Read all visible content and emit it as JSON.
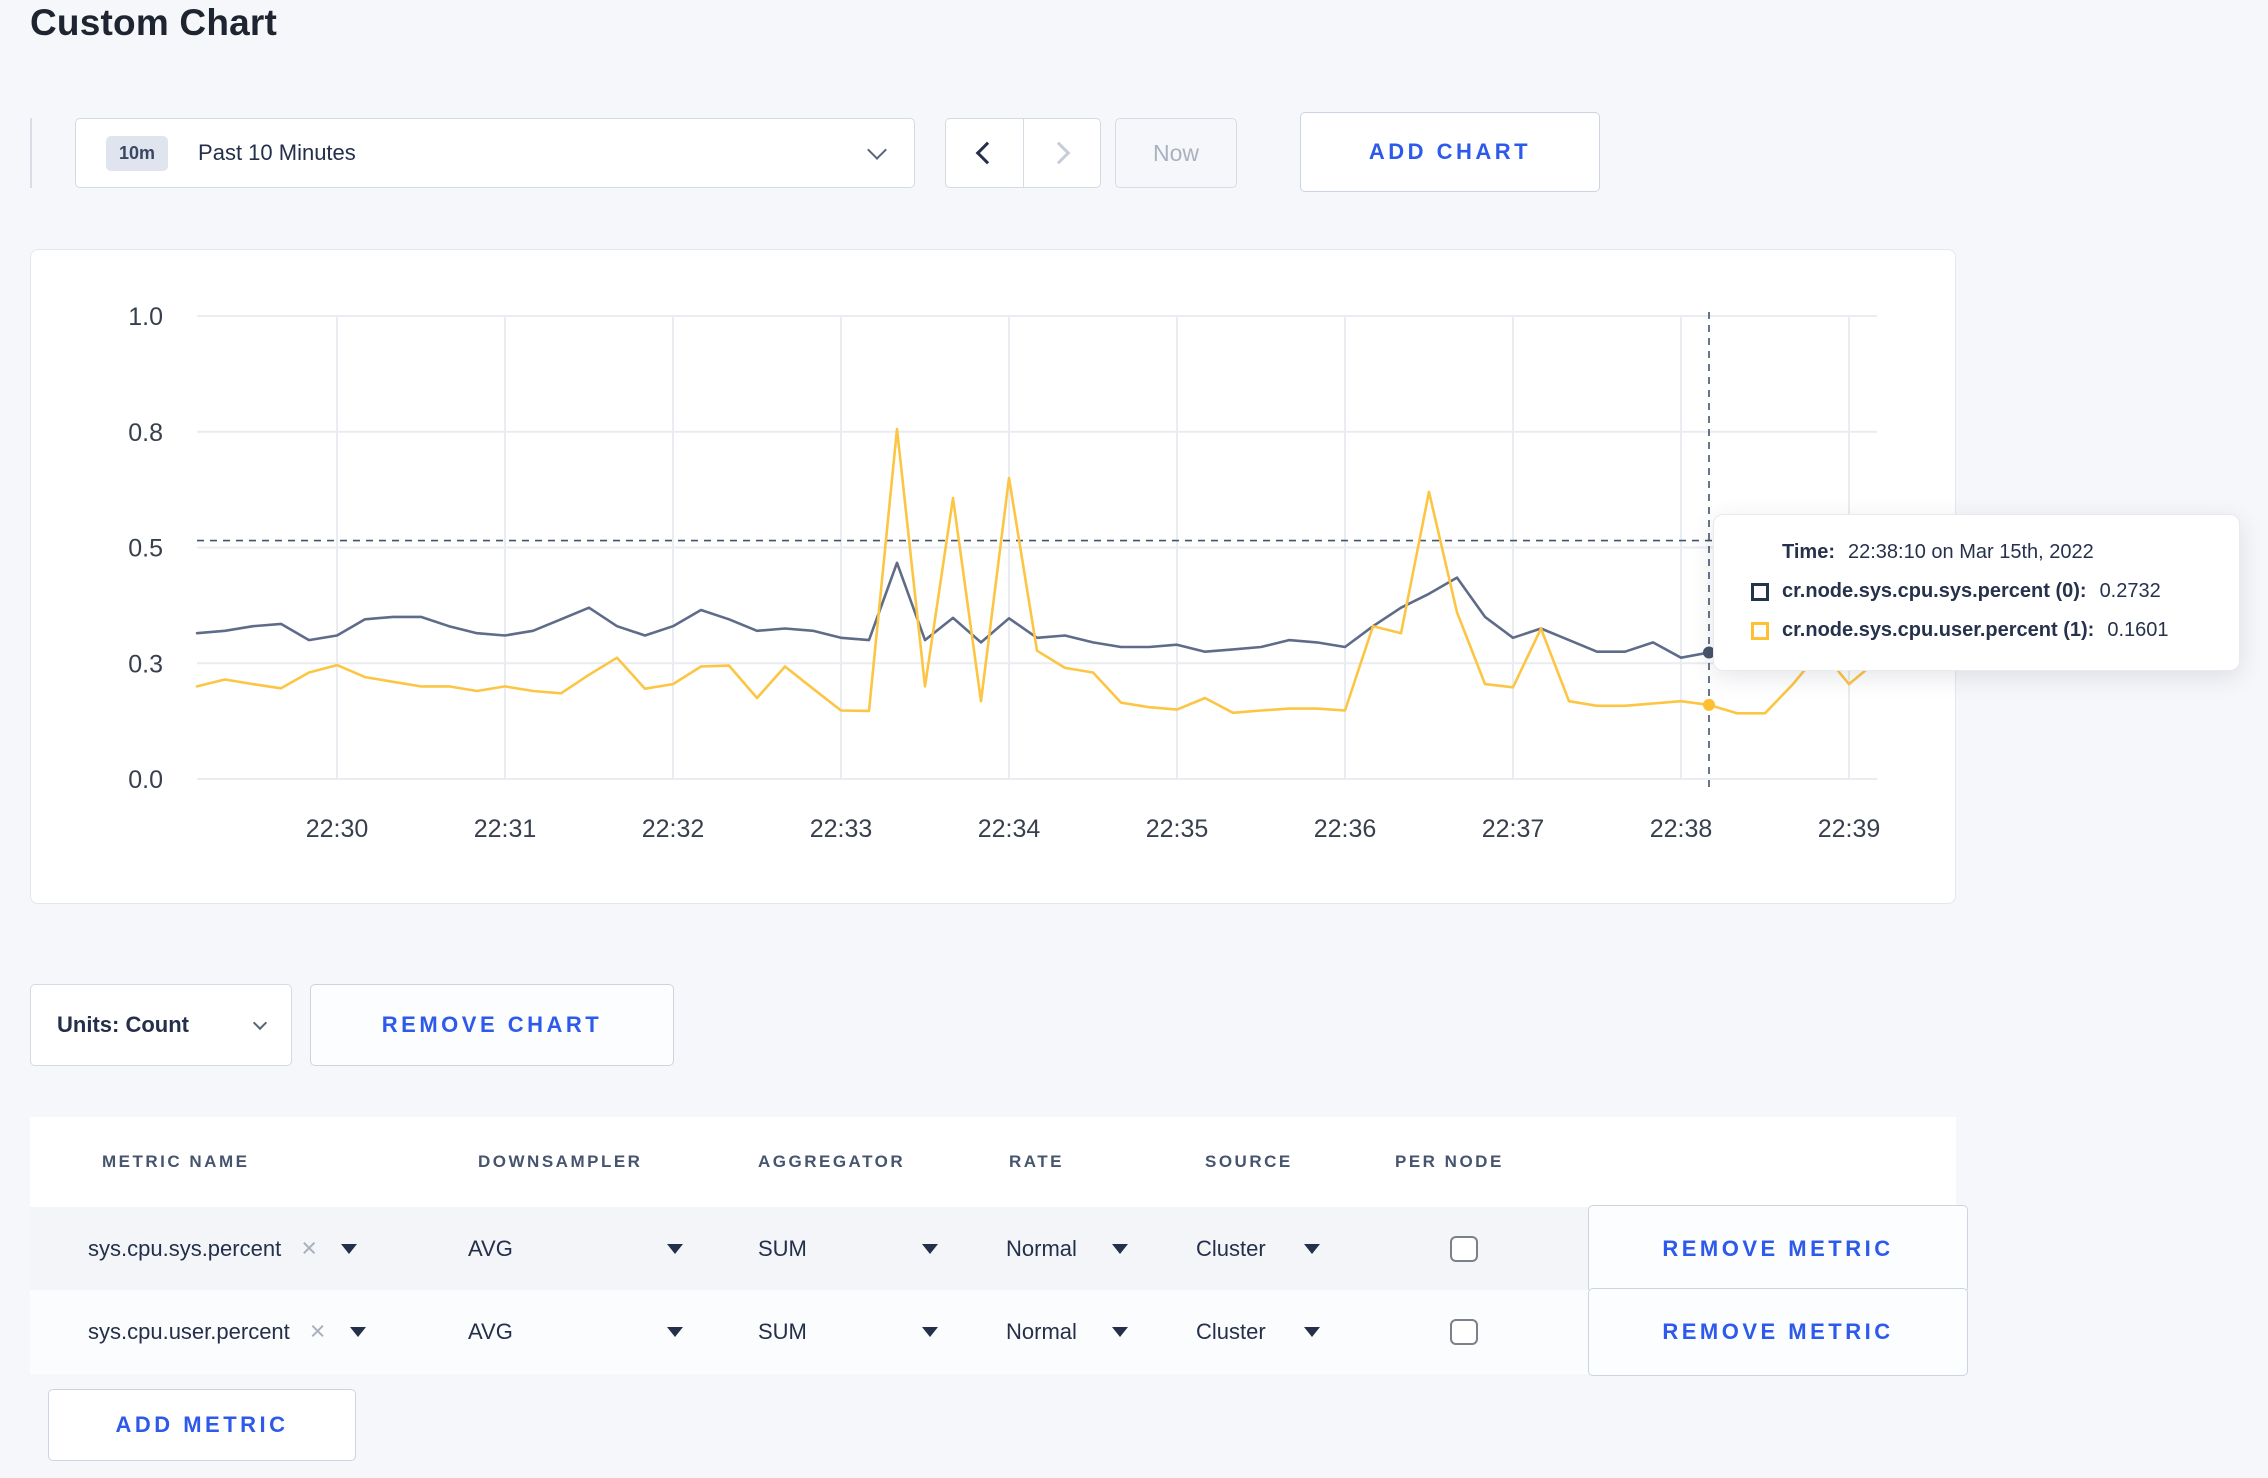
{
  "page": {
    "title": "Custom Chart",
    "background_color": "#f6f7fa",
    "accent_blue": "#2d5aeb"
  },
  "toolbar": {
    "time_badge": "10m",
    "time_label": "Past 10 Minutes",
    "now_label": "Now",
    "add_chart_label": "ADD CHART"
  },
  "chart_data": {
    "type": "line",
    "title": "",
    "xlabel": "",
    "ylabel": "",
    "ylim": [
      0,
      1
    ],
    "grid": true,
    "x_start_time": "22:29:10",
    "x_end_time": "22:39:10",
    "sample_interval_seconds": 10,
    "y_ticks": [
      {
        "v": 0,
        "label": "0.0"
      },
      {
        "v": 0.25,
        "label": "0.3"
      },
      {
        "v": 0.5,
        "label": "0.5"
      },
      {
        "v": 0.75,
        "label": "0.8"
      },
      {
        "v": 1,
        "label": "1.0"
      }
    ],
    "x_ticks": [
      {
        "t": 50,
        "label": "22:30"
      },
      {
        "t": 110,
        "label": "22:31"
      },
      {
        "t": 170,
        "label": "22:32"
      },
      {
        "t": 230,
        "label": "22:33"
      },
      {
        "t": 290,
        "label": "22:34"
      },
      {
        "t": 350,
        "label": "22:35"
      },
      {
        "t": 410,
        "label": "22:36"
      },
      {
        "t": 470,
        "label": "22:37"
      },
      {
        "t": 530,
        "label": "22:38"
      },
      {
        "t": 590,
        "label": "22:39"
      }
    ],
    "series": [
      {
        "name": "cr.node.sys.cpu.sys.percent",
        "color": "#5e6c89",
        "dot_color": "#46536b",
        "legend_color": "#26324c",
        "values": [
          0.315,
          0.32,
          0.33,
          0.335,
          0.3,
          0.31,
          0.345,
          0.35,
          0.35,
          0.33,
          0.315,
          0.31,
          0.32,
          0.345,
          0.37,
          0.33,
          0.31,
          0.33,
          0.365,
          0.345,
          0.32,
          0.325,
          0.32,
          0.305,
          0.3,
          0.467,
          0.3,
          0.348,
          0.295,
          0.347,
          0.305,
          0.31,
          0.295,
          0.285,
          0.285,
          0.29,
          0.275,
          0.28,
          0.285,
          0.3,
          0.295,
          0.285,
          0.33,
          0.37,
          0.4,
          0.435,
          0.35,
          0.305,
          0.325,
          0.3,
          0.275,
          0.275,
          0.295,
          0.262,
          0.2732,
          0.285,
          0.295,
          0.29,
          0.305,
          0.295,
          0.305
        ]
      },
      {
        "name": "cr.node.sys.cpu.user.percent",
        "color": "#fcc543",
        "dot_color": "#fcc030",
        "legend_color": "#fdc133",
        "values": [
          0.2,
          0.215,
          0.205,
          0.196,
          0.23,
          0.246,
          0.22,
          0.21,
          0.2,
          0.2,
          0.19,
          0.2,
          0.19,
          0.185,
          0.225,
          0.262,
          0.195,
          0.205,
          0.243,
          0.245,
          0.175,
          0.243,
          0.195,
          0.148,
          0.147,
          0.756,
          0.2,
          0.607,
          0.168,
          0.65,
          0.277,
          0.24,
          0.23,
          0.165,
          0.155,
          0.15,
          0.175,
          0.143,
          0.148,
          0.152,
          0.152,
          0.148,
          0.33,
          0.315,
          0.62,
          0.36,
          0.205,
          0.198,
          0.325,
          0.168,
          0.158,
          0.158,
          0.163,
          0.168,
          0.1601,
          0.142,
          0.142,
          0.205,
          0.278,
          0.205,
          0.255
        ]
      }
    ],
    "hover": {
      "t": 540,
      "time": "22:38:10",
      "crosshair_value": 0.515
    },
    "legend_position": "tooltip"
  },
  "tooltip": {
    "time_label": "Time:",
    "time_value": "22:38:10 on Mar 15th, 2022",
    "items": [
      {
        "label": "cr.node.sys.cpu.sys.percent (0):",
        "value": "0.2732"
      },
      {
        "label": "cr.node.sys.cpu.user.percent (1):",
        "value": "0.1601"
      }
    ]
  },
  "chart_footer": {
    "units_label": "Units: Count",
    "remove_chart_label": "REMOVE CHART"
  },
  "metrics_table": {
    "headers": [
      "METRIC NAME",
      "DOWNSAMPLER",
      "AGGREGATOR",
      "RATE",
      "SOURCE",
      "PER NODE"
    ],
    "close_glyph": "×",
    "rows": [
      {
        "metric": "sys.cpu.sys.percent",
        "downsampler": "AVG",
        "aggregator": "SUM",
        "rate": "Normal",
        "source": "Cluster",
        "per_node_checked": false,
        "remove_label": "REMOVE METRIC"
      },
      {
        "metric": "sys.cpu.user.percent",
        "downsampler": "AVG",
        "aggregator": "SUM",
        "rate": "Normal",
        "source": "Cluster",
        "per_node_checked": false,
        "remove_label": "REMOVE METRIC"
      }
    ],
    "add_metric_label": "ADD METRIC"
  }
}
